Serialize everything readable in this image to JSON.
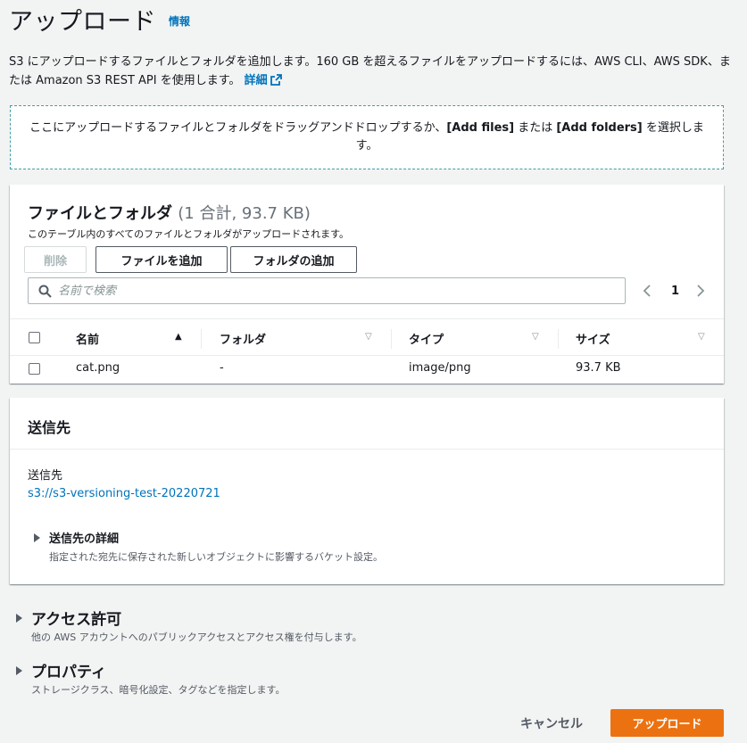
{
  "header": {
    "title": "アップロード",
    "info_link": "情報"
  },
  "description": {
    "text": "S3 にアップロードするファイルとフォルダを追加します。160 GB を超えるファイルをアップロードするには、AWS CLI、AWS SDK、または Amazon S3 REST API を使用します。",
    "link": "詳細",
    "link_icon": "external-link-icon"
  },
  "dropzone": {
    "text_before": "ここにアップロードするファイルとフォルダをドラッグアンドドロップするか、",
    "add_files": "[Add files]",
    "middle": " または ",
    "add_folders": "[Add folders]",
    "text_after": " を選択します。"
  },
  "files": {
    "title": "ファイルとフォルダ",
    "count": "(1 合計, 93.7 KB)",
    "subtitle": "このテーブル内のすべてのファイルとフォルダがアップロードされます。",
    "delete_button": "削除",
    "add_files_button": "ファイルを追加",
    "add_folder_button": "フォルダの追加",
    "search_placeholder": "名前で検索",
    "page": "1",
    "columns": [
      "名前",
      "フォルダ",
      "タイプ",
      "サイズ"
    ],
    "rows": [
      {
        "name": "cat.png",
        "folder": "-",
        "type": "image/png",
        "size": "93.7 KB"
      }
    ]
  },
  "destination": {
    "title": "送信先",
    "label": "送信先",
    "path": "s3://s3-versioning-test-20220721",
    "details_title": "送信先の詳細",
    "details_sub": "指定された宛先に保存された新しいオブジェクトに影響するバケット設定。"
  },
  "permissions": {
    "title": "アクセス許可",
    "sub": "他の AWS アカウントへのパブリックアクセスとアクセス権を付与します。"
  },
  "properties": {
    "title": "プロパティ",
    "sub": "ストレージクラス、暗号化設定、タグなどを指定します。"
  },
  "footer": {
    "cancel": "キャンセル",
    "upload": "アップロード"
  },
  "colors": {
    "accent": "#ec7211",
    "link": "#0073bb",
    "background": "#f2f3f3"
  }
}
